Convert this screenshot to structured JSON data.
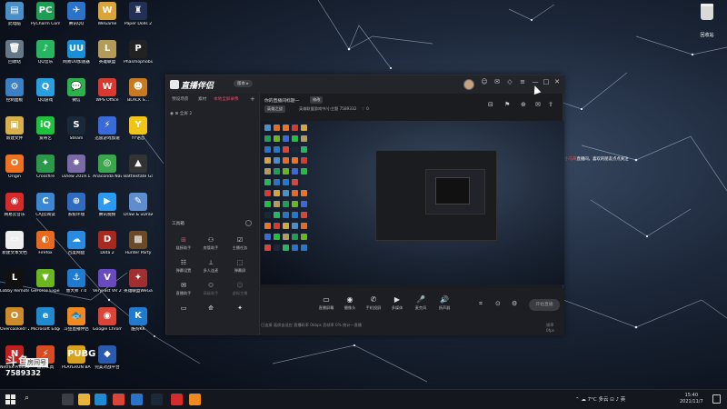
{
  "desktop": {
    "icons": [
      {
        "label": "此电脑",
        "glyph": "▤",
        "color": "#4a90c8"
      },
      {
        "label": "PyCharm Community...",
        "glyph": "PC",
        "color": "#1f9d55"
      },
      {
        "label": "腾讯QQ",
        "glyph": "✈",
        "color": "#2a73c9"
      },
      {
        "label": "WeGame",
        "glyph": "W",
        "color": "#d9a53a"
      },
      {
        "label": "Paper Dolls 2",
        "glyph": "♜",
        "color": "#223055"
      },
      {
        "label": "回收站",
        "glyph": "🗑",
        "color": "#667788"
      },
      {
        "label": "QQ音乐",
        "glyph": "♪",
        "color": "#27b562"
      },
      {
        "label": "网易UU加速器",
        "glyph": "UU",
        "color": "#1a8fd8"
      },
      {
        "label": "英雄联盟",
        "glyph": "L",
        "color": "#b59b5a"
      },
      {
        "label": "Phasmophobia",
        "glyph": "P",
        "color": "#222222"
      },
      {
        "label": "控制面板",
        "glyph": "⚙",
        "color": "#3b7fc4"
      },
      {
        "label": "QQ游戏",
        "glyph": "Q",
        "color": "#28a0e0"
      },
      {
        "label": "微信",
        "glyph": "💬",
        "color": "#2bb24c"
      },
      {
        "label": "WPS Office",
        "glyph": "W",
        "color": "#d93a2f"
      },
      {
        "label": "BLACK S...",
        "glyph": "☻",
        "color": "#c77a1f"
      },
      {
        "label": "新建文件",
        "glyph": "▣",
        "color": "#d8b04a"
      },
      {
        "label": "爱奇艺",
        "glyph": "iQ",
        "color": "#1fc03d"
      },
      {
        "label": "Steam",
        "glyph": "S",
        "color": "#1b2838"
      },
      {
        "label": "迅雷游戏加速",
        "glyph": "⚡",
        "color": "#3a6ad9"
      },
      {
        "label": "YY语音",
        "glyph": "Y",
        "color": "#f0c419"
      },
      {
        "label": "Origin",
        "glyph": "O",
        "color": "#f0711f"
      },
      {
        "label": "Crossfire",
        "glyph": "✦",
        "color": "#2a9a4a"
      },
      {
        "label": "uView 2019.1...",
        "glyph": "✸",
        "color": "#7a6aa8"
      },
      {
        "label": "Anaconda Navigato...",
        "glyph": "◎",
        "color": "#3aa84a"
      },
      {
        "label": "Battlestate Games...",
        "glyph": "▲",
        "color": "#333333"
      },
      {
        "label": "网易云音乐",
        "glyph": "◉",
        "color": "#d52b2b"
      },
      {
        "label": "CAJ云阅读",
        "glyph": "C",
        "color": "#3b87d4"
      },
      {
        "label": "系统环境",
        "glyph": "⊕",
        "color": "#2f6bbf"
      },
      {
        "label": "腾讯视频",
        "glyph": "▶",
        "color": "#2b9af3"
      },
      {
        "label": "Draw & uDraw",
        "glyph": "✎",
        "color": "#5e8ed0"
      },
      {
        "label": "新建文本文档",
        "glyph": "▭",
        "color": "#eeeeee"
      },
      {
        "label": "Firefox",
        "glyph": "◐",
        "color": "#e66a1f"
      },
      {
        "label": "百度网盘",
        "glyph": "☁",
        "color": "#2a8ae0"
      },
      {
        "label": "Dota 2",
        "glyph": "D",
        "color": "#a82a1f"
      },
      {
        "label": "Hunter Party",
        "glyph": "▩",
        "color": "#6b4a2a"
      },
      {
        "label": "Lobby Remote",
        "glyph": "L",
        "color": "#111111"
      },
      {
        "label": "GeForce Experience",
        "glyph": "▼",
        "color": "#6bb51f"
      },
      {
        "label": "鲁大师 7.0",
        "glyph": "⚓",
        "color": "#1f7ad0"
      },
      {
        "label": "VeryFast VR 2020",
        "glyph": "V",
        "color": "#6a4ac0"
      },
      {
        "label": "英雄联盟WeGame版",
        "glyph": "✦",
        "color": "#a03030"
      },
      {
        "label": "Overcooked! 2",
        "glyph": "O",
        "color": "#cc8a2a"
      },
      {
        "label": "Microsoft Edge",
        "glyph": "e",
        "color": "#1f8ad0"
      },
      {
        "label": "斗鱼直播伴侣",
        "glyph": "🐟",
        "color": "#f08a1f"
      },
      {
        "label": "Google Chrome",
        "glyph": "◉",
        "color": "#db4437"
      },
      {
        "label": "酷狗KK",
        "glyph": "K",
        "color": "#1f7ad0"
      },
      {
        "label": "Netflix Premium...",
        "glyph": "N",
        "color": "#c01f1f"
      },
      {
        "label": "雷神工具",
        "glyph": "⚡",
        "color": "#d84a1f"
      },
      {
        "label": "PLAYERUN BATTLEGR...",
        "glyph": "PUBG",
        "color": "#d8a21f"
      },
      {
        "label": "完美对战平台",
        "glyph": "◆",
        "color": "#2a5ab0"
      }
    ],
    "recycle_label": "回收站",
    "live_text_before": "欢迎",
    "live_text_highlight": "斗鱼TV小马哥",
    "live_text_after": "直播间，喜欢的朋友点点关注",
    "watermark": {
      "logo": "斗鱼",
      "tag": "房间号",
      "room": "7589332"
    }
  },
  "app": {
    "title": "直播伴侣",
    "version_badge": "版本 ▸",
    "window_controls": [
      "☺",
      "✉",
      "◇",
      "≡",
      "—",
      "□",
      "✕"
    ],
    "tabs": [
      "预设场景",
      "素材",
      "本地全屏录像"
    ],
    "add_tab": "+",
    "scene_toggle": "◉ ⊞ 全屏 2",
    "tools_label": "工具箱",
    "tools": [
      {
        "label": "链接助手",
        "glyph": "⊞"
      },
      {
        "label": "房管助手",
        "glyph": "⚇"
      },
      {
        "label": "主播任务",
        "glyph": "☑"
      },
      {
        "label": "弹幕设置",
        "glyph": "☷"
      },
      {
        "label": "多人连麦",
        "glyph": "⊥"
      },
      {
        "label": "弹幕屏",
        "glyph": "⬚"
      },
      {
        "label": "直播助手",
        "glyph": "✉"
      },
      {
        "label": "高级助手",
        "glyph": "✪"
      },
      {
        "label": "虚拟主播",
        "glyph": "☺"
      },
      {
        "label": "",
        "glyph": "▭"
      },
      {
        "label": "",
        "glyph": "⟰"
      },
      {
        "label": "",
        "glyph": "✦"
      }
    ],
    "room_title": "你的直播间标题—",
    "room_tag": "修改",
    "room_category": "英雄之战",
    "room_sub": "英雄联盟游戏中/小主题  7589332",
    "room_likes": "♡ 0",
    "right_icons": [
      "⌂",
      "⊟",
      "⚑",
      "⊕",
      "✉",
      "⇪"
    ],
    "bottom_buttons": [
      {
        "label": "直播屏幕",
        "glyph": "▭"
      },
      {
        "label": "摄像头",
        "glyph": "◉"
      },
      {
        "label": "手机投屏",
        "glyph": "✆"
      },
      {
        "label": "多媒体",
        "glyph": "▶"
      },
      {
        "label": "麦克风",
        "glyph": "🎤"
      },
      {
        "label": "扬声器",
        "glyph": "🔊"
      }
    ],
    "small_icons": [
      "⌗",
      "⊙",
      "⚙"
    ],
    "start_live": "开始直播",
    "status": "已连接  画质自适应  直播码率 0kbps  丢帧率 0%  统计一直播",
    "status_right": "帧率 0fps"
  },
  "taskbar": {
    "search_icon": "⌕",
    "apps": [
      {
        "name": "task-view",
        "color": "#3a3f48"
      },
      {
        "name": "file-explorer",
        "color": "#e8b43a"
      },
      {
        "name": "edge",
        "color": "#1f8ad0"
      },
      {
        "name": "chrome",
        "color": "#db4437"
      },
      {
        "name": "qq",
        "color": "#2a73c9"
      },
      {
        "name": "steam",
        "color": "#1b2838"
      },
      {
        "name": "netease-music",
        "color": "#d52b2b"
      },
      {
        "name": "douyu",
        "color": "#f08a1f"
      }
    ],
    "tray": "⌃  ☁  7°C 多云  ⊡  ♪  英",
    "time": "15:40",
    "date": "2021/11/7"
  }
}
